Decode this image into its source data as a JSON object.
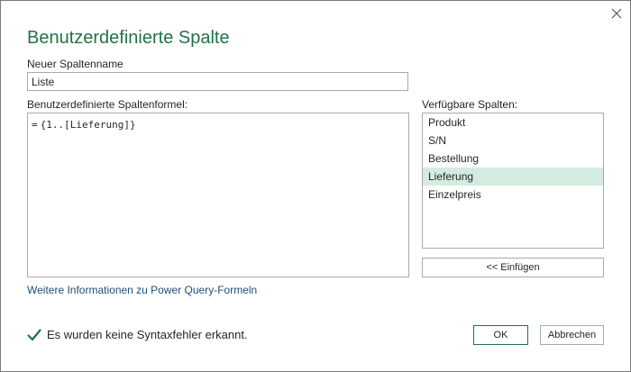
{
  "dialog": {
    "title": "Benutzerdefinierte Spalte",
    "close_icon": "close-icon"
  },
  "name_field": {
    "label": "Neuer Spaltenname",
    "value": "Liste"
  },
  "formula": {
    "label": "Benutzerdefinierte Spaltenformel:",
    "prefix": "=",
    "value": "{1..[Lieferung]}"
  },
  "columns": {
    "label": "Verfügbare Spalten:",
    "items": [
      "Produkt",
      "S/N",
      "Bestellung",
      "Lieferung",
      "Einzelpreis"
    ],
    "selected": "Lieferung",
    "insert_label": "<< Einfügen"
  },
  "help_link": "Weitere Informationen zu Power Query-Formeln",
  "status": {
    "icon": "checkmark-icon",
    "text": "Es wurden keine Syntaxfehler erkannt."
  },
  "buttons": {
    "ok": "OK",
    "cancel": "Abbrechen"
  },
  "colors": {
    "accent": "#217346",
    "selection": "#d4ece0",
    "link": "#1f4e79"
  }
}
